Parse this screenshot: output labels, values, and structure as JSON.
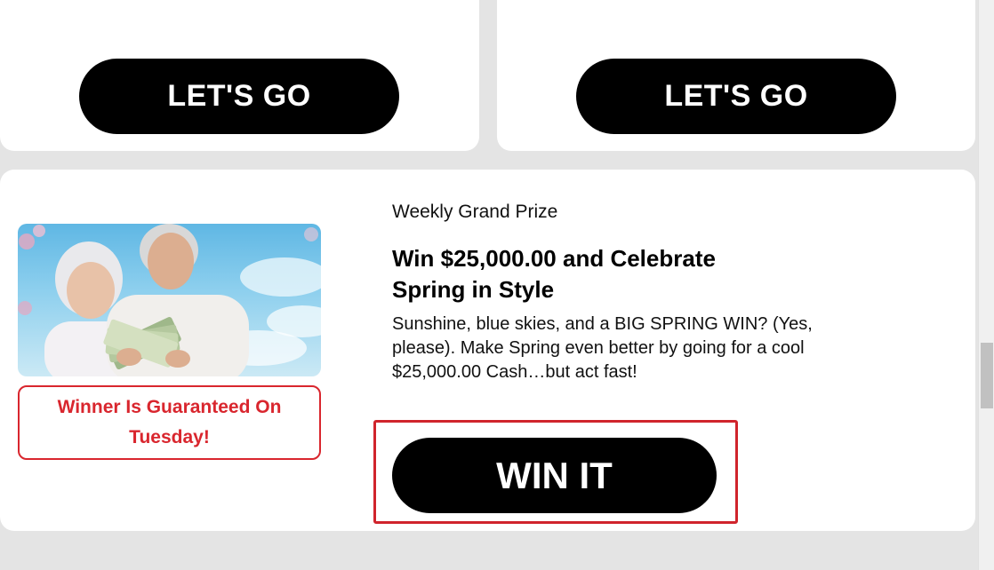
{
  "cards_top": [
    {
      "cta_label": "LET'S GO"
    },
    {
      "cta_label": "LET'S GO"
    }
  ],
  "promo": {
    "image_alt": "Smiling senior couple holding cash",
    "guarantee_text": "Winner Is Guaranteed On Tuesday!",
    "eyebrow": "Weekly Grand Prize",
    "headline": "Win $25,000.00 and Celebrate Spring in Style",
    "description": "Sunshine, blue skies, and a BIG SPRING WIN? (Yes, please). Make Spring even better by going for a cool $25,000.00 Cash…but act fast!",
    "cta_label": "WIN IT"
  },
  "colors": {
    "accent_red": "#d9262e",
    "button_black": "#000000",
    "page_bg": "#e4e4e4"
  }
}
